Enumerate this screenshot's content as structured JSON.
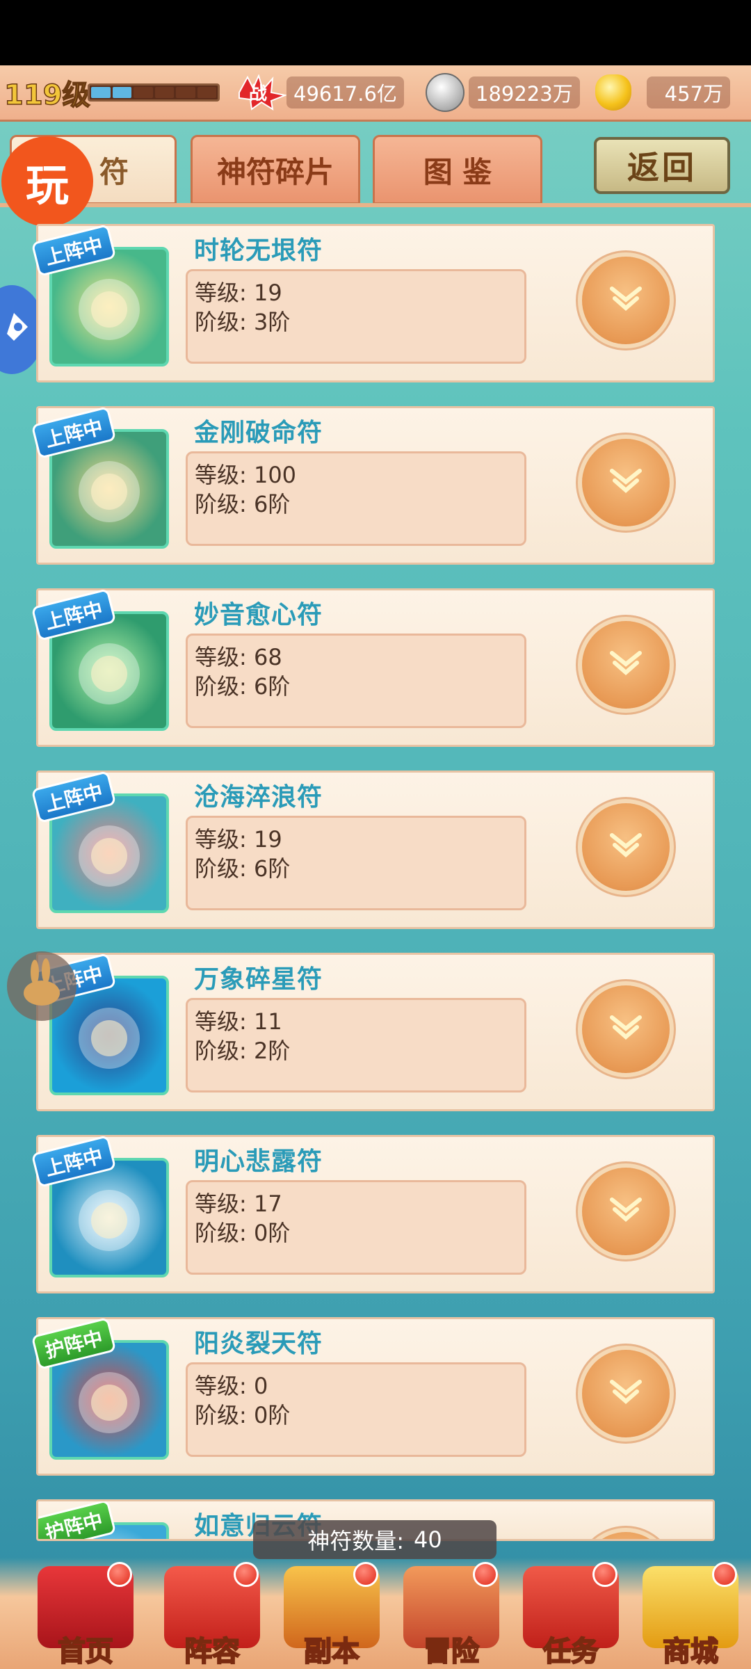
{
  "topbar": {
    "level": "119级",
    "xp_segments_filled": 2,
    "xp_segments_total": 6,
    "combat_icon_text": "战",
    "combat_power": "49617.6亿",
    "silver": "189223万",
    "gold": "457万"
  },
  "tabs": [
    {
      "label": "符",
      "active": true
    },
    {
      "label": "神符碎片",
      "active": false
    },
    {
      "label": "图 鉴",
      "active": false
    }
  ],
  "back_label": "返回",
  "play_badge": "玩",
  "cards": [
    {
      "name": "时轮无垠符",
      "level": "等级: 19",
      "tier": "阶级: 3阶",
      "badge": "上阵中",
      "badge_color": "blue"
    },
    {
      "name": "金刚破命符",
      "level": "等级: 100",
      "tier": "阶级: 6阶",
      "badge": "上阵中",
      "badge_color": "blue"
    },
    {
      "name": "妙音愈心符",
      "level": "等级: 68",
      "tier": "阶级: 6阶",
      "badge": "上阵中",
      "badge_color": "blue"
    },
    {
      "name": "沧海淬浪符",
      "level": "等级: 19",
      "tier": "阶级: 6阶",
      "badge": "上阵中",
      "badge_color": "blue"
    },
    {
      "name": "万象碎星符",
      "level": "等级: 11",
      "tier": "阶级: 2阶",
      "badge": "上阵中",
      "badge_color": "blue"
    },
    {
      "name": "明心悲露符",
      "level": "等级: 17",
      "tier": "阶级: 0阶",
      "badge": "上阵中",
      "badge_color": "blue"
    },
    {
      "name": "阳炎裂天符",
      "level": "等级: 0",
      "tier": "阶级: 0阶",
      "badge": "护阵中",
      "badge_color": "green"
    },
    {
      "name": "如意归云符",
      "level": "",
      "tier": "",
      "badge": "护阵中",
      "badge_color": "green"
    }
  ],
  "count": {
    "label": "神符数量:",
    "value": "40"
  },
  "nav": [
    {
      "label": "首页",
      "icon": "home-gate-icon"
    },
    {
      "label": "阵容",
      "icon": "lineup-scroll-icon"
    },
    {
      "label": "副本",
      "icon": "dungeon-icon"
    },
    {
      "label": "冒险",
      "icon": "adventure-fist-icon"
    },
    {
      "label": "任务",
      "icon": "quest-icon"
    },
    {
      "label": "商城",
      "icon": "shop-gold-icon"
    }
  ],
  "colors": {
    "badge_blue": "#1b78c9",
    "badge_green": "#2d9b2a",
    "rune_name": "#2a9bb8"
  }
}
